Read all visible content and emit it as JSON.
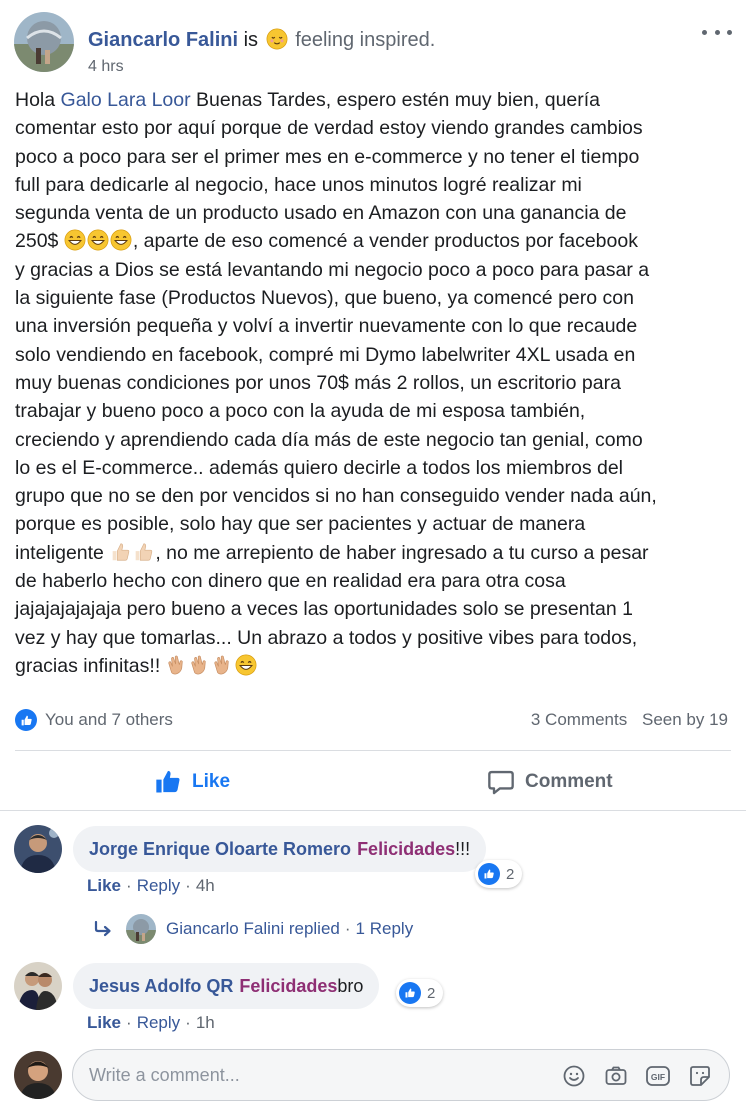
{
  "post": {
    "author": "Giancarlo Falini",
    "is_text": "is",
    "feeling_text": "feeling inspired.",
    "time": "4 hrs",
    "mention": "Galo Lara Loor",
    "line_01_pre": "Hola ",
    "line_01_post": " Buenas Tardes, espero estén muy bien, quería",
    "line_02": "comentar esto por aquí porque de verdad estoy viendo grandes cambios",
    "line_03": "poco a poco para ser el primer mes en e-commerce y no tener el tiempo",
    "line_04": "full para dedicarle al negocio, hace unos minutos logré realizar mi",
    "line_05": "segunda venta de un producto usado en Amazon con una ganancia de",
    "line_06_pre": "250$ ",
    "line_06_post": ", aparte de eso comencé a vender productos por facebook",
    "line_07": "y gracias a Dios se está levantando mi negocio poco a poco para pasar a",
    "line_08": "la siguiente fase (Productos Nuevos), que bueno, ya comencé pero con",
    "line_09": "una inversión pequeña y volví a invertir nuevamente con lo que recaude",
    "line_10": "solo vendiendo en facebook, compré mi Dymo labelwriter 4XL usada en",
    "line_11": "muy buenas condiciones por unos 70$ más 2 rollos, un escritorio para",
    "line_12": "trabajar y bueno poco a poco con la ayuda de mi esposa también,",
    "line_13": "creciendo y aprendiendo cada día más de este negocio tan genial, como",
    "line_14": "lo es el E-commerce.. además quiero decirle a todos los miembros del",
    "line_15": "grupo que no se den por vencidos si no han conseguido vender nada aún,",
    "line_16": "porque es posible, solo hay que ser pacientes y actuar de manera",
    "line_17_pre": "inteligente ",
    "line_17_post": ", no me arrepiento de haber ingresado a tu curso a pesar",
    "line_18": "de haberlo hecho con dinero que en realidad era para otra cosa",
    "line_19": "jajajajajajaja pero bueno a veces las oportunidades solo se presentan 1",
    "line_20": "vez y hay que tomarlas... Un abrazo a todos y positive vibes para todos,",
    "line_21_pre": "gracias infinitas!! "
  },
  "stats": {
    "likes_text": "You and 7 others",
    "comments_text": "3 Comments",
    "seen_text": "Seen by 19"
  },
  "actions": {
    "like_label": "Like",
    "comment_label": "Comment"
  },
  "comments": [
    {
      "author": "Jorge Enrique Oloarte Romero",
      "highlight": "Felicidades",
      "rest": " !!!",
      "like_label": "Like",
      "reply_label": "Reply",
      "time": "4h",
      "reaction_count": "2"
    },
    {
      "author": "Jesus Adolfo QR",
      "highlight": "Felicidades",
      "rest": " bro",
      "like_label": "Like",
      "reply_label": "Reply",
      "time": "1h",
      "reaction_count": "2"
    }
  ],
  "reply_summary": {
    "text": "Giancarlo Falini replied",
    "count_text": "1 Reply"
  },
  "composer": {
    "placeholder": "Write a comment..."
  },
  "colors": {
    "link_blue": "#385898",
    "like_blue": "#1877f2",
    "highlight_purple": "#8e2f74",
    "meta_gray": "#606770"
  },
  "icons": {
    "feeling_emoji": "relieved-face-emoji",
    "grin_emoji": "grinning-face-emoji",
    "thumbs_emoji": "thumbs-up-emoji",
    "clap_emoji": "clapping-hands-emoji"
  }
}
